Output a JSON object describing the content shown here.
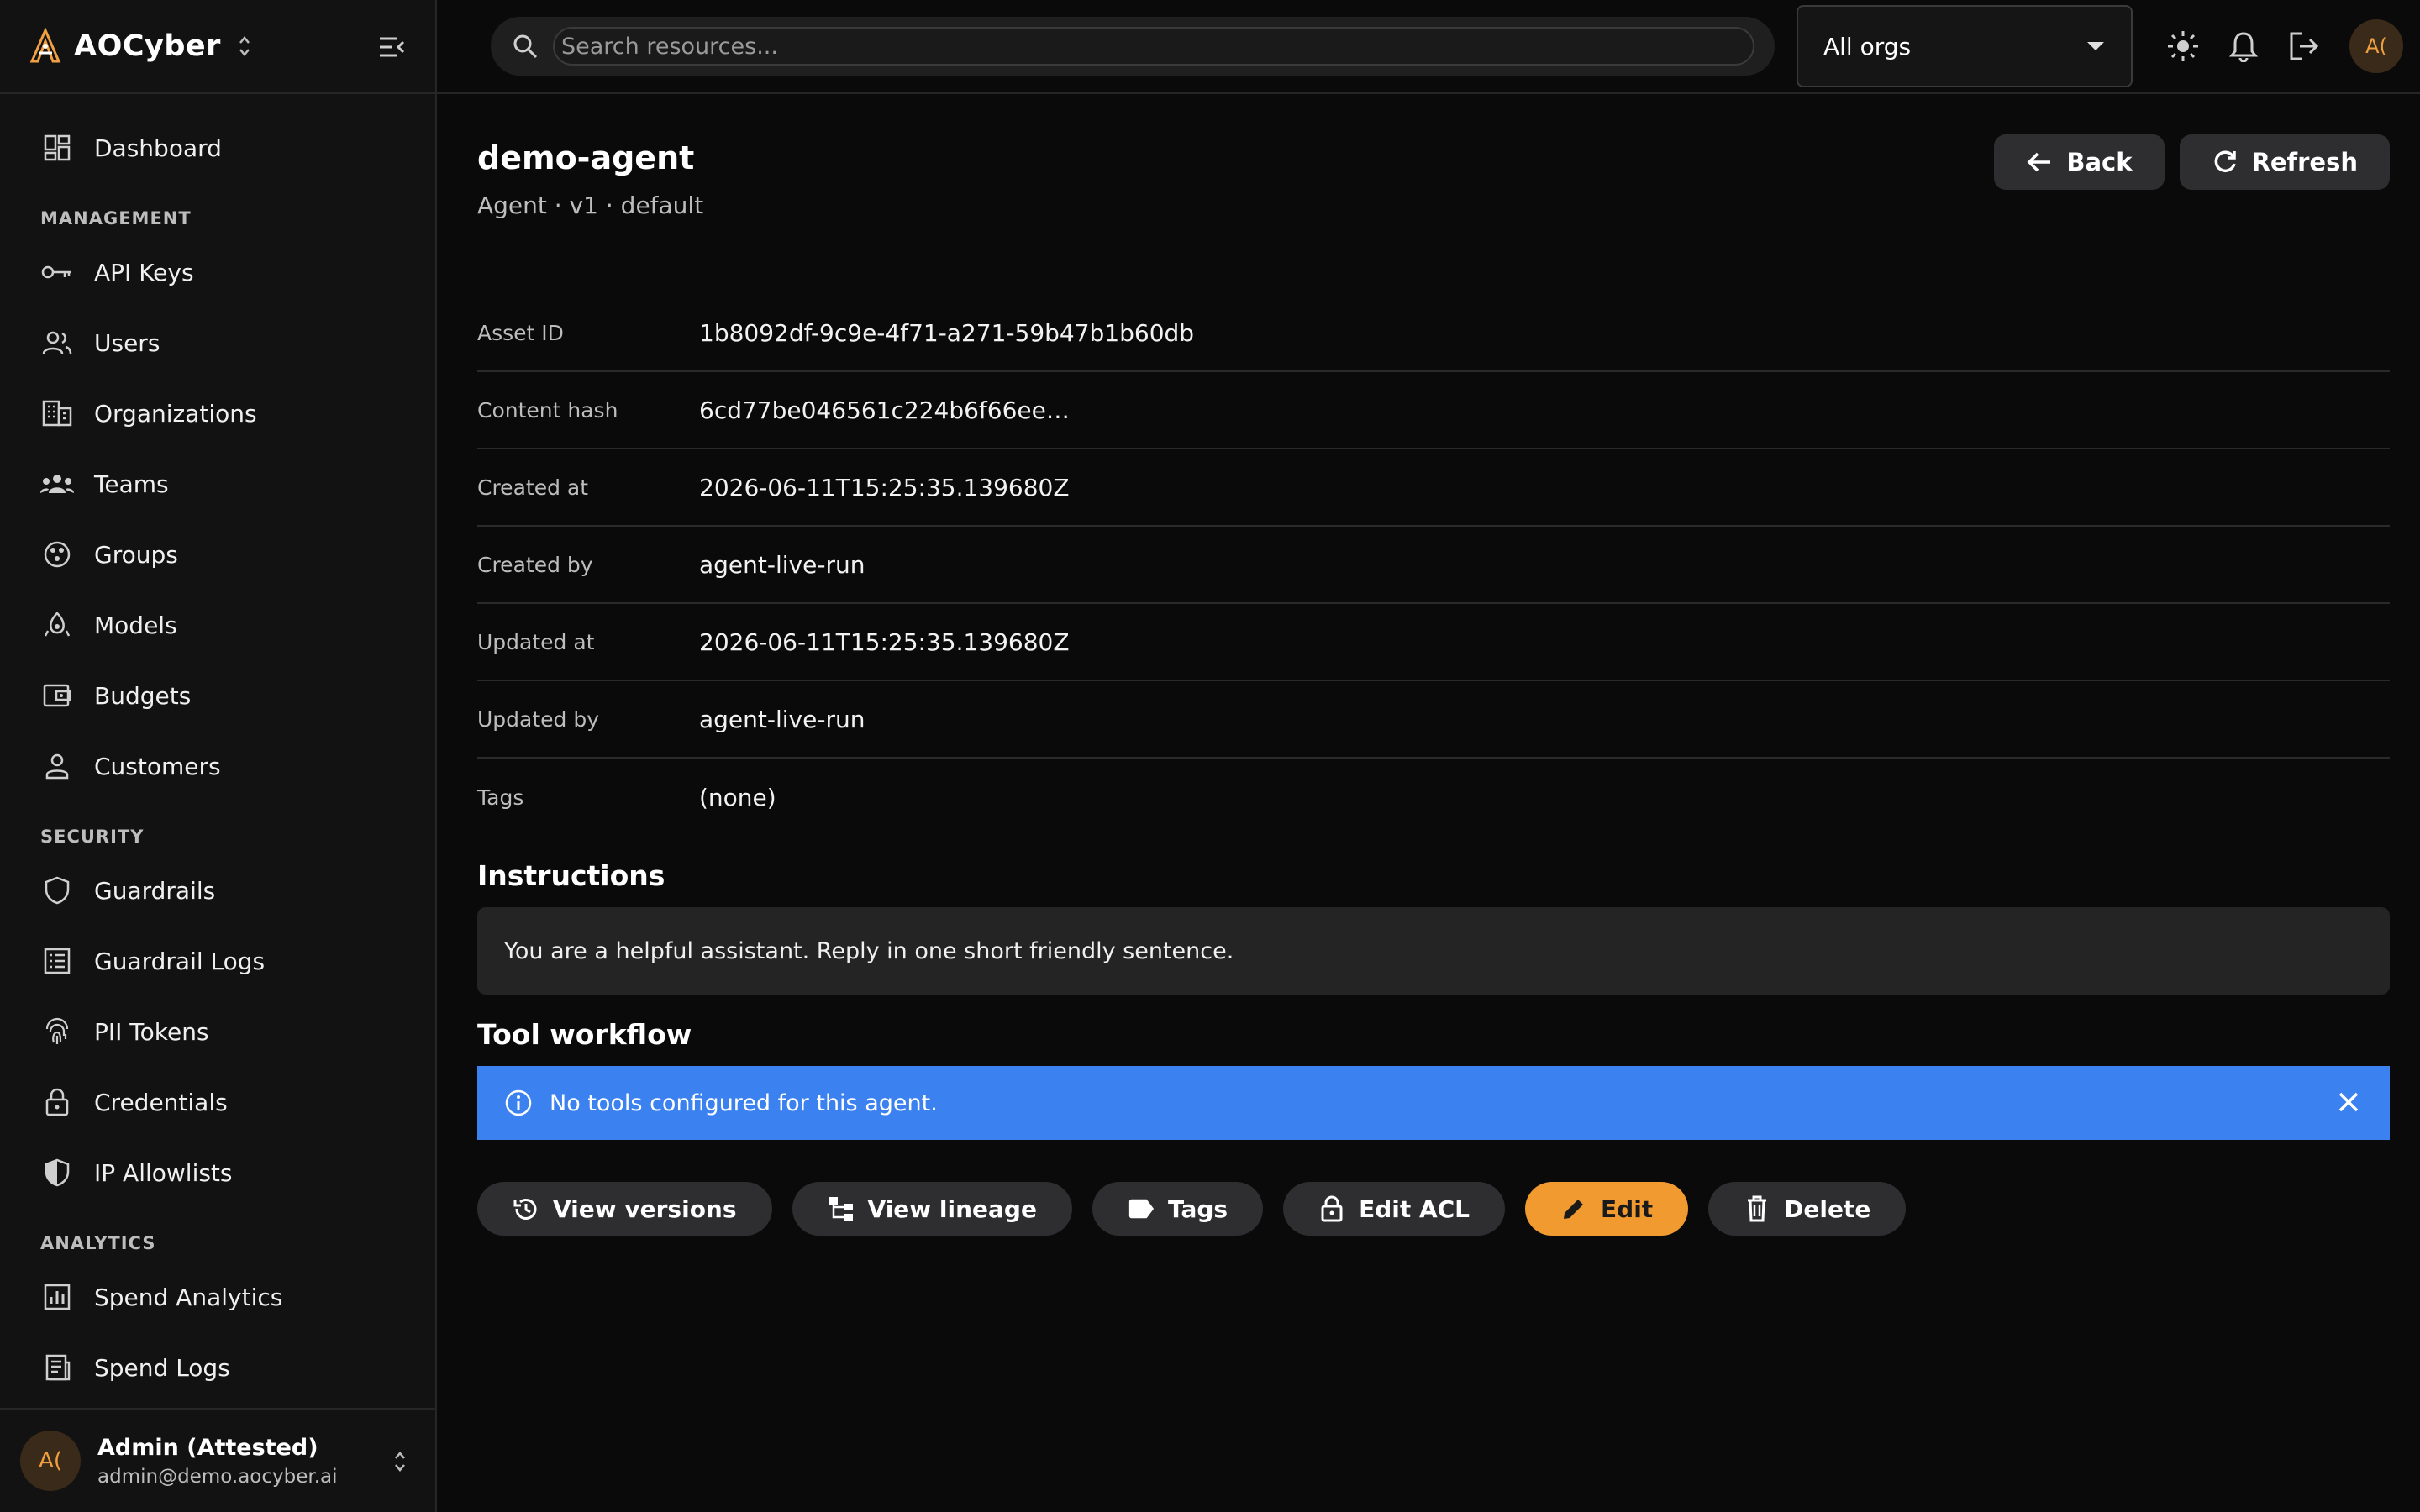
{
  "brand": {
    "name": "AOCyber"
  },
  "sidebar": {
    "top_items": [
      {
        "label": "Dashboard",
        "icon": "dashboard-icon"
      }
    ],
    "sections": [
      {
        "title": "MANAGEMENT",
        "items": [
          {
            "label": "API Keys",
            "icon": "key-icon"
          },
          {
            "label": "Users",
            "icon": "users-icon"
          },
          {
            "label": "Organizations",
            "icon": "building-icon"
          },
          {
            "label": "Teams",
            "icon": "teams-icon"
          },
          {
            "label": "Groups",
            "icon": "groups-icon"
          },
          {
            "label": "Models",
            "icon": "models-icon"
          },
          {
            "label": "Budgets",
            "icon": "wallet-icon"
          },
          {
            "label": "Customers",
            "icon": "customer-icon"
          }
        ]
      },
      {
        "title": "SECURITY",
        "items": [
          {
            "label": "Guardrails",
            "icon": "shield-icon"
          },
          {
            "label": "Guardrail Logs",
            "icon": "list-icon"
          },
          {
            "label": "PII Tokens",
            "icon": "fingerprint-icon"
          },
          {
            "label": "Credentials",
            "icon": "lock-icon"
          },
          {
            "label": "IP Allowlists",
            "icon": "shield-half-icon"
          }
        ]
      },
      {
        "title": "ANALYTICS",
        "items": [
          {
            "label": "Spend Analytics",
            "icon": "bar-chart-icon"
          },
          {
            "label": "Spend Logs",
            "icon": "receipt-icon"
          }
        ]
      }
    ],
    "user": {
      "initials": "A(",
      "name": "Admin (Attested)",
      "email": "admin@demo.aocyber.ai"
    }
  },
  "topbar": {
    "search_placeholder": "Search resources...",
    "org_select": "All orgs",
    "avatar_initials": "A("
  },
  "page": {
    "title": "demo-agent",
    "subtitle": "Agent · v1 · default",
    "back_label": "Back",
    "refresh_label": "Refresh",
    "properties": [
      {
        "key": "Asset ID",
        "value": "1b8092df-9c9e-4f71-a271-59b47b1b60db"
      },
      {
        "key": "Content hash",
        "value": "6cd77be046561c224b6f66ee…"
      },
      {
        "key": "Created at",
        "value": "2026-06-11T15:25:35.139680Z"
      },
      {
        "key": "Created by",
        "value": "agent-live-run"
      },
      {
        "key": "Updated at",
        "value": "2026-06-11T15:25:35.139680Z"
      },
      {
        "key": "Updated by",
        "value": "agent-live-run"
      },
      {
        "key": "Tags",
        "value": "(none)"
      }
    ],
    "instructions_title": "Instructions",
    "instructions_text": "You are a helpful assistant. Reply in one short friendly sentence.",
    "tool_workflow_title": "Tool workflow",
    "alert_text": "No tools configured for this agent.",
    "actions": {
      "view_versions": "View versions",
      "view_lineage": "View lineage",
      "tags": "Tags",
      "edit_acl": "Edit ACL",
      "edit": "Edit",
      "delete": "Delete"
    }
  },
  "colors": {
    "accent": "#f09a30",
    "info": "#3b82f0",
    "background": "#0a0a0a",
    "sidebar": "#121212"
  }
}
